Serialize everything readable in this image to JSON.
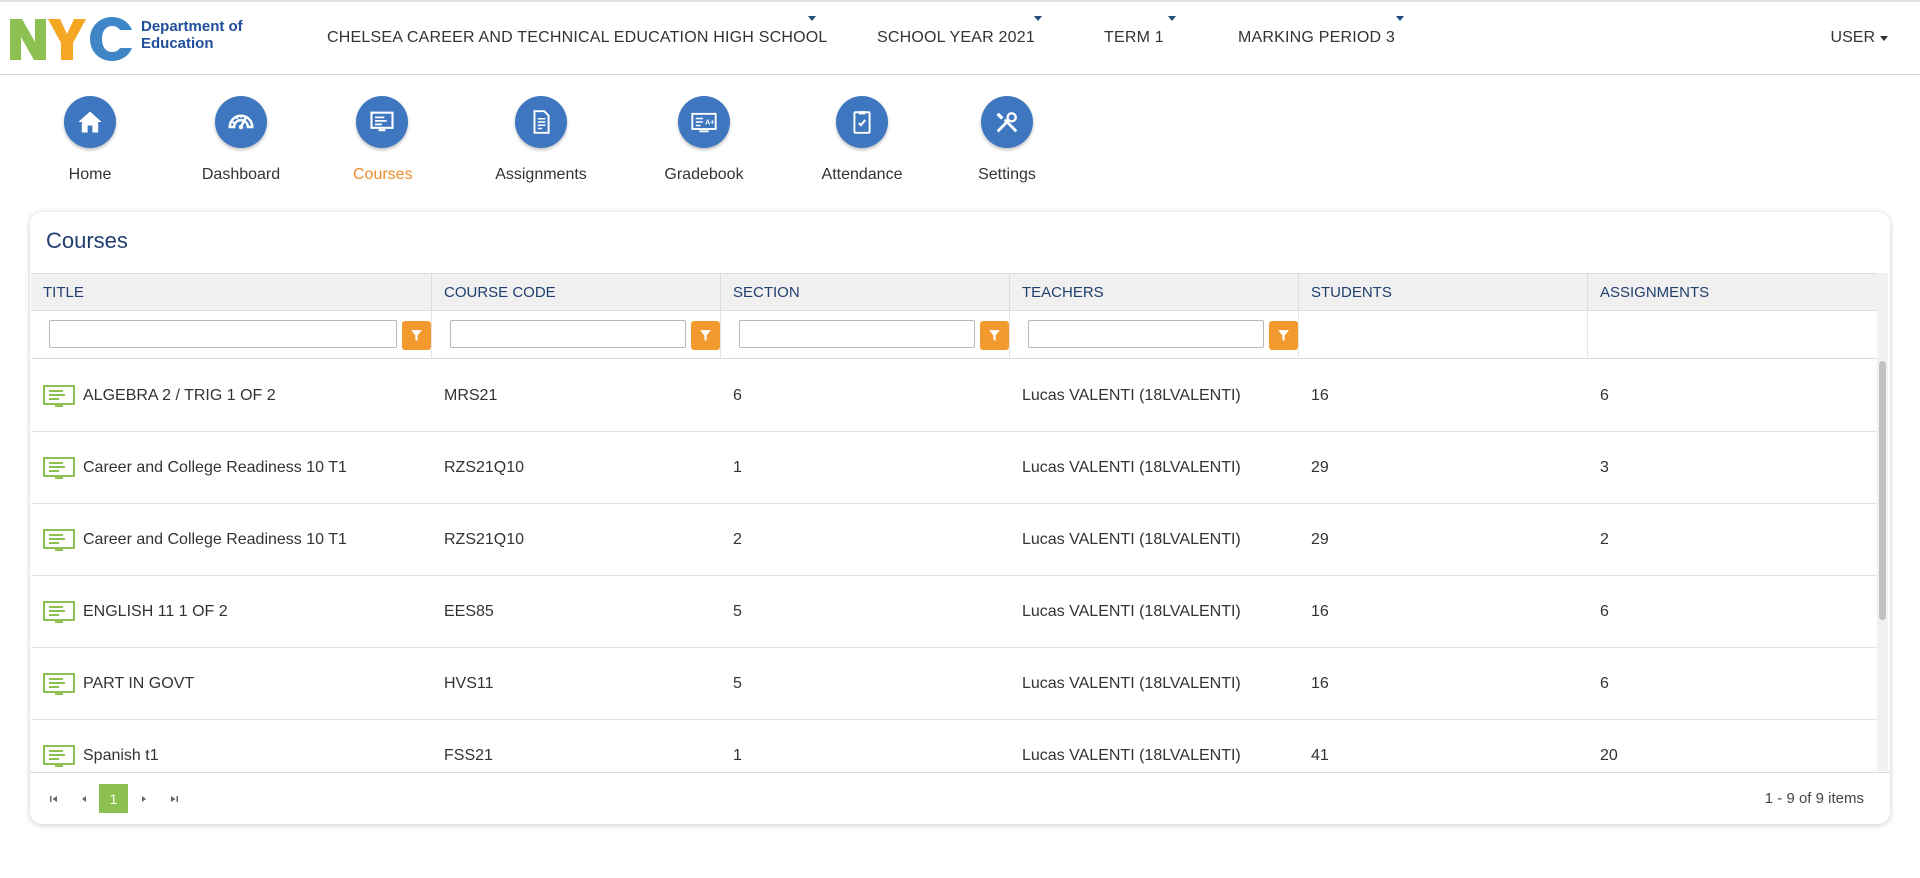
{
  "logo": {
    "wordmark": "NYC",
    "org_name": "Department of Education"
  },
  "topnav": {
    "school": "CHELSEA CAREER AND TECHNICAL EDUCATION HIGH SCHOOL",
    "school_year": "SCHOOL YEAR 2021",
    "term": "TERM 1",
    "marking_period": "MARKING PERIOD 3",
    "user": "USER"
  },
  "mainnav": {
    "active": "Courses",
    "items": [
      {
        "label": "Home",
        "icon": "home-icon"
      },
      {
        "label": "Dashboard",
        "icon": "dashboard-gauge-icon"
      },
      {
        "label": "Courses",
        "icon": "courses-board-icon"
      },
      {
        "label": "Assignments",
        "icon": "document-icon"
      },
      {
        "label": "Gradebook",
        "icon": "gradebook-icon"
      },
      {
        "label": "Attendance",
        "icon": "clipboard-check-icon"
      },
      {
        "label": "Settings",
        "icon": "tools-icon"
      }
    ]
  },
  "courses": {
    "title": "Courses",
    "columns": [
      "TITLE",
      "COURSE CODE",
      "SECTION",
      "TEACHERS",
      "STUDENTS",
      "ASSIGNMENTS"
    ],
    "rows": [
      {
        "title": "ALGEBRA 2 / TRIG 1 OF 2",
        "code": "MRS21",
        "section": "6",
        "teachers": "Lucas VALENTI (18LVALENTI)",
        "students": "16",
        "assignments": "6"
      },
      {
        "title": "Career and College Readiness 10 T1",
        "code": "RZS21Q10",
        "section": "1",
        "teachers": "Lucas VALENTI (18LVALENTI)",
        "students": "29",
        "assignments": "3"
      },
      {
        "title": "Career and College Readiness 10 T1",
        "code": "RZS21Q10",
        "section": "2",
        "teachers": "Lucas VALENTI (18LVALENTI)",
        "students": "29",
        "assignments": "2"
      },
      {
        "title": "ENGLISH 11 1 OF 2",
        "code": "EES85",
        "section": "5",
        "teachers": "Lucas VALENTI (18LVALENTI)",
        "students": "16",
        "assignments": "6"
      },
      {
        "title": "PART IN GOVT",
        "code": "HVS11",
        "section": "5",
        "teachers": "Lucas VALENTI (18LVALENTI)",
        "students": "16",
        "assignments": "6"
      },
      {
        "title": "Spanish t1",
        "code": "FSS21",
        "section": "1",
        "teachers": "Lucas VALENTI (18LVALENTI)",
        "students": "41",
        "assignments": "20"
      }
    ],
    "pager": {
      "current_page": "1",
      "info": "1 - 9 of 9 items"
    }
  },
  "colors": {
    "accent": "#3e76bf",
    "active": "#ef8b2c",
    "filter": "#f39a2f",
    "course_icon": "#8cc152",
    "heading": "#1f3f6e"
  }
}
